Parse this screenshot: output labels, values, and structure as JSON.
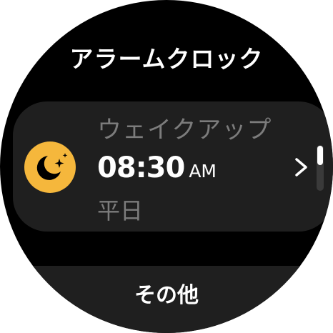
{
  "screen": {
    "title": "アラームクロック"
  },
  "alarm": {
    "label": "ウェイクアップ",
    "time": "08:30",
    "ampm": "AM",
    "days": "平日",
    "icon": "moon-stars-icon",
    "icon_color": "#f5b73c"
  },
  "scroll": {
    "position": 0.0
  },
  "footer": {
    "other_label": "その他"
  },
  "colors": {
    "background": "#000000",
    "card": "#1f1f1f",
    "secondary_text": "#7c7c7c",
    "primary_text": "#ffffff"
  }
}
